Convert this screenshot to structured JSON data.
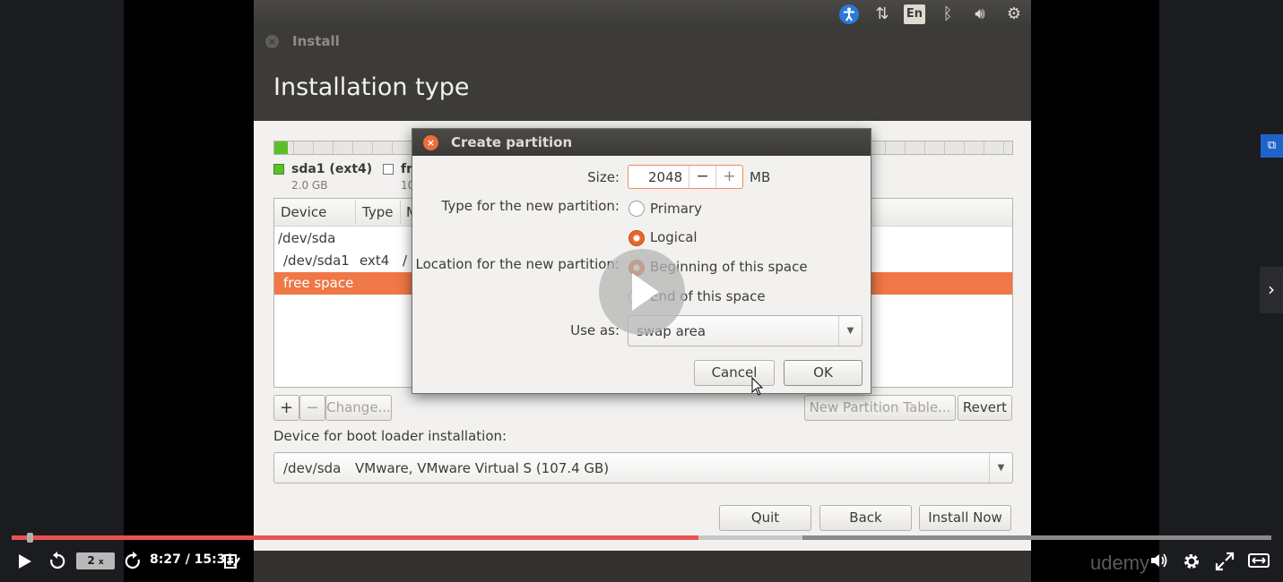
{
  "window": {
    "title": "Install",
    "heading": "Installation type"
  },
  "legend": [
    {
      "name": "sda1 (ext4)",
      "size": "2.0 GB",
      "color": "#5cbf2a"
    },
    {
      "name": "fr",
      "size": "10"
    }
  ],
  "table": {
    "headers": [
      "Device",
      "Type",
      "M"
    ],
    "rows": [
      {
        "device": "/dev/sda",
        "type": "",
        "mount": ""
      },
      {
        "device": "/dev/sda1",
        "type": "ext4",
        "mount": "/"
      },
      {
        "device": "free space",
        "type": "",
        "mount": "",
        "selected": true
      }
    ]
  },
  "partition_buttons": {
    "add": "+",
    "remove": "−",
    "change": "Change...",
    "new_table": "New Partition Table...",
    "revert": "Revert"
  },
  "bootloader": {
    "label": "Device for boot loader installation:",
    "device": "/dev/sda",
    "description": "VMware, VMware Virtual S (107.4 GB)"
  },
  "footer_buttons": {
    "quit": "Quit",
    "back": "Back",
    "install": "Install Now"
  },
  "dialog": {
    "title": "Create partition",
    "size_label": "Size:",
    "size_value": "2048",
    "size_unit": "MB",
    "minus": "−",
    "plus": "+",
    "type_label": "Type for the new partition:",
    "type_options": [
      {
        "label": "Primary",
        "selected": false
      },
      {
        "label": "Logical",
        "selected": true
      }
    ],
    "location_label": "Location for the new partition:",
    "location_options": [
      {
        "label": "Beginning of this space",
        "selected": true
      },
      {
        "label": "End of this space",
        "selected": false
      }
    ],
    "use_as_label": "Use as:",
    "use_as_value": "swap area",
    "cancel": "Cancel",
    "ok": "OK"
  },
  "topbar_icons": [
    "accessibility-icon",
    "network-icon",
    "keyboard-layout-icon",
    "bluetooth-icon",
    "volume-icon",
    "power-gear-icon"
  ],
  "keyboard_layout": "En",
  "player": {
    "speed": "2",
    "speed_suffix": "x",
    "time": "8:27 / 15:31",
    "progress": 0.545,
    "buffered": 0.628,
    "brand": "udemy",
    "accent": "#ec5252"
  }
}
